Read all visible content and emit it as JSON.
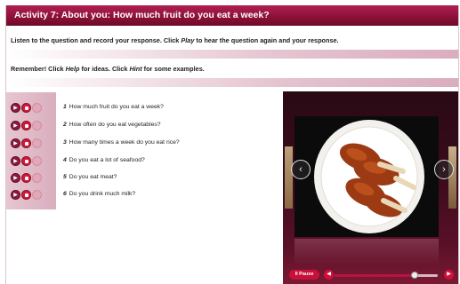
{
  "title": "Activity 7: About you: How much fruit do you eat a week?",
  "instructions": {
    "line1_prefix": "Listen to the question and record your response. Click ",
    "line1_em": "Play",
    "line1_suffix": " to hear the question again and your response.",
    "line2_prefix": "Remember! Click ",
    "line2_em1": "Help",
    "line2_mid": " for ideas. Click ",
    "line2_em2": "Hint",
    "line2_suffix": " for some examples."
  },
  "questions": [
    {
      "num": "1",
      "text": "How much fruit do you eat a week?"
    },
    {
      "num": "2",
      "text": "How often do you eat vegetables?"
    },
    {
      "num": "3",
      "text": "How many times a week do you eat rice?"
    },
    {
      "num": "4",
      "text": "Do you eat a lot of seafood?"
    },
    {
      "num": "5",
      "text": "Do you eat meat?"
    },
    {
      "num": "6",
      "text": "Do you drink much milk?"
    }
  ],
  "player": {
    "pause_label": "II Pause",
    "progress": 0.78
  },
  "colors": {
    "accent": "#8a1036",
    "record": "#d2193a"
  }
}
